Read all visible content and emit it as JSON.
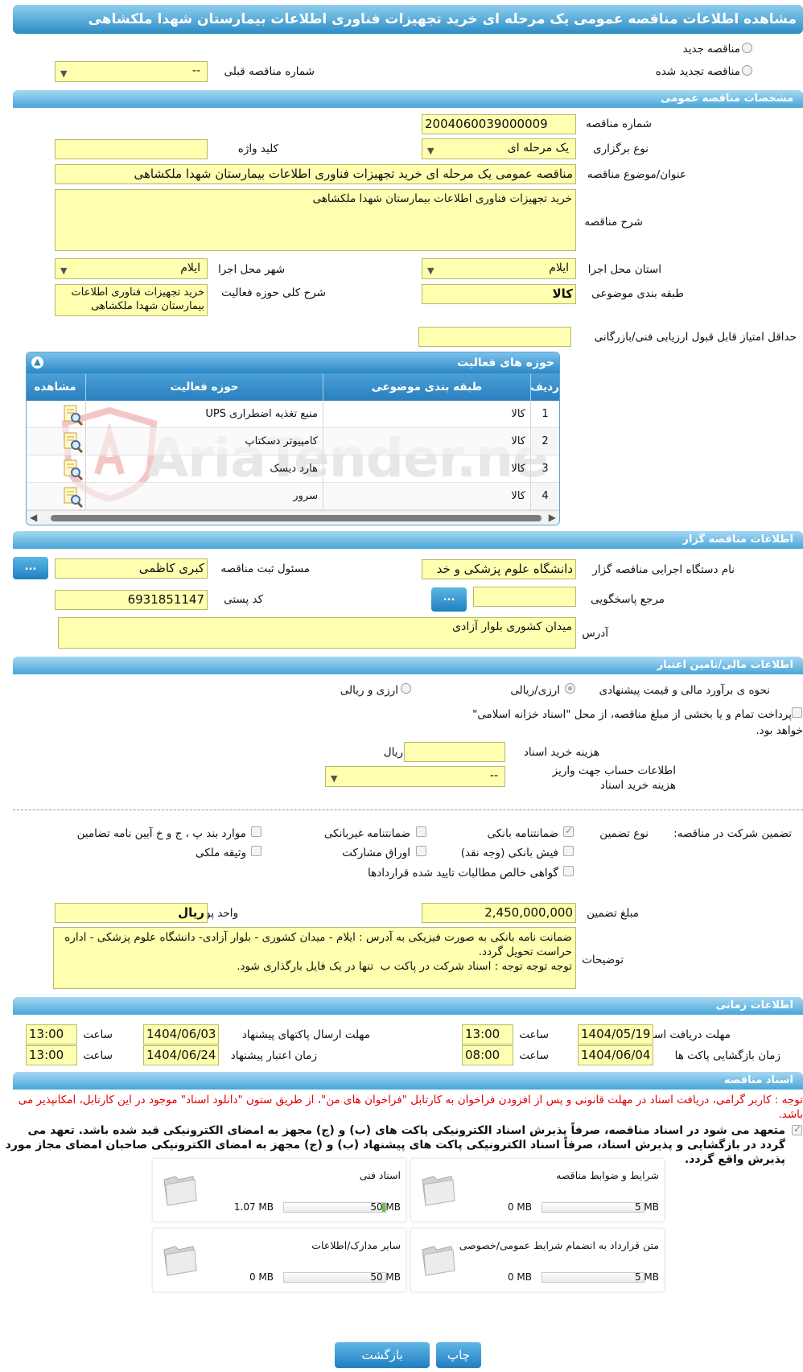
{
  "title": "مشاهده اطلاعات مناقصه عمومی یک مرحله ای خرید تجهیزات فناوری اطلاعات بیمارستان شهدا ملکشاهی",
  "top": {
    "new_tender": "مناقصه جدید",
    "renewed_tender": "مناقصه تجدید شده",
    "prev_number_label": "شماره مناقصه قبلی",
    "prev_number_value": "--"
  },
  "general": {
    "header": "مشخصات مناقصه عمومی",
    "number_label": "شماره مناقصه",
    "number_value": "2004060039000009",
    "type_label": "نوع برگزاری",
    "type_value": "یک مرحله ای",
    "keyword_label": "کلید واژه",
    "keyword_value": "",
    "subject_label": "عنوان/موضوع مناقصه",
    "subject_value": "مناقصه عمومی یک مرحله ای خرید تجهیزات فناوری اطلاعات بیمارستان شهدا ملکشاهی",
    "desc_label": "شرح مناقصه",
    "desc_value": "خرید تجهیزات فناوری اطلاعات بیمارستان شهدا ملکشاهی",
    "province_label": "استان محل اجرا",
    "province_value": "ایلام",
    "city_label": "شهر محل اجرا",
    "city_value": "ایلام",
    "category_label": "طبقه بندی موضوعی",
    "category_value": "کالا",
    "scope_label": "شرح کلی حوزه فعالیت",
    "scope_value": "خرید تجهیزات فناوری اطلاعات بیمارستان شهدا ملکشاهی",
    "min_score_label": "حداقل امتیاز قابل قبول ارزیابی فنی/بازرگانی",
    "min_score_value": ""
  },
  "activities": {
    "title": "حوزه های فعالیت",
    "columns": [
      "ردیف",
      "طبقه بندی موضوعی",
      "حوزه فعالیت",
      "مشاهده"
    ],
    "rows": [
      {
        "idx": "1",
        "cat": "کالا",
        "field": "منبع تغذیه اضطراری UPS"
      },
      {
        "idx": "2",
        "cat": "کالا",
        "field": "کامپیوتر دسکتاپ"
      },
      {
        "idx": "3",
        "cat": "کالا",
        "field": "هارد دیسک"
      },
      {
        "idx": "4",
        "cat": "کالا",
        "field": "سرور"
      }
    ],
    "watermark": "AriaTender.neT"
  },
  "organizer": {
    "header": "اطلاعات مناقصه گزار",
    "org_label": "نام دستگاه اجرایی مناقصه گزار",
    "org_value": "دانشگاه علوم پزشکی و خد",
    "resp_label": "مسئول ثبت مناقصه",
    "resp_value": "کبری کاظمی",
    "ref_label": "مرجع پاسخگویی",
    "ref_value": "",
    "postal_label": "کد پستی",
    "postal_value": "6931851147",
    "address_label": "آدرس",
    "address_value": "میدان کشوری بلوار آزادی",
    "dots": "..."
  },
  "finance": {
    "header": "اطلاعات مالی/تامین اعتبار",
    "estimate_label": "نحوه ی برآورد مالی و قیمت پیشنهادی",
    "opt_currency": "ارزی/ریالی",
    "opt_currency_rial": "ارزی و ریالی",
    "treasury_text": "پرداخت تمام و یا بخشی از مبلغ مناقصه، از محل \"اسناد خزانه اسلامی\"",
    "treasury_text2": "خواهد بود.",
    "doc_cost_label": "هزینه خرید اسناد",
    "doc_cost_value": "",
    "doc_cost_unit": "ریال",
    "account_label": "اطلاعات حساب جهت واریز هزینه خرید اسناد",
    "account_value": "--"
  },
  "guarantee": {
    "participation_label": "تضمین شرکت در مناقصه:",
    "type_label": "نوع تضمین",
    "bank_guarantee": "ضمانتنامه بانکی",
    "non_bank_guarantee": "ضمانتنامه غیربانکی",
    "clauses": "موارد بند پ ، ج و خ آیین نامه تضامین",
    "bank_receipt": "فیش بانکی (وجه نقد)",
    "participation_papers": "اوراق مشارکت",
    "property_bond": "وثیقه ملکی",
    "net_claims": "گواهی خالص مطالبات تایید شده قراردادها",
    "amount_label": "مبلغ تضمین",
    "amount_value": "2,450,000,000",
    "currency_label": "واحد پول",
    "currency_value": "ریال",
    "notes_label": "توضیحات",
    "notes_value": "ضمانت نامه بانکی به صورت فیزیکی به آدرس : ایلام - میدان کشوری - بلوار آزادی- دانشگاه علوم پزشکی - اداره حراست تحویل گردد.\nتوجه توجه توجه : اسناد شرکت در پاکت ب  تنها در یک فایل بارگذاری شود."
  },
  "timing": {
    "header": "اطلاعات زمانی",
    "receive_label": "مهلت دریافت اسناد",
    "receive_date": "1404/05/19",
    "receive_time": "13:00",
    "send_label": "مهلت ارسال پاکتهای پیشنهاد",
    "send_date": "1404/06/03",
    "send_time": "13:00",
    "open_label": "زمان بازگشایی پاکت ها",
    "open_date": "1404/06/04",
    "open_time": "08:00",
    "valid_label": "زمان اعتبار پیشنهاد",
    "valid_date": "1404/06/24",
    "valid_time": "13:00",
    "time_word": "ساعت"
  },
  "documents": {
    "header": "اسناد مناقصه",
    "red_note": "توجه : کاربر گرامی، دریافت اسناد در مهلت قانونی و پس از افزودن فراخوان به کارتابل \"فراخوان های من\"، از طریق ستون \"دانلود اسناد\" موجود در این کارتابل، امکانپذیر می باشد.",
    "bold_note": "متعهد می شود در اسناد مناقصه، صرفاً پذیرش اسناد الکترونیکی پاکت های (ب) و (ج) مجهز به امضای الکترونیکی قید شده باشد. تعهد می گردد در بازگشایی و پذیرش اسناد، صرفاً اسناد الکترونیکی پاکت های پیشنهاد (ب) و (ج) مجهز به امضای الکترونیکی صاحبان امضای مجاز مورد پذیرش واقع گردد.",
    "files": [
      {
        "name": "شرایط و ضوابط مناقصه",
        "used": "0 MB",
        "max": "5 MB",
        "fill": 0
      },
      {
        "name": "اسناد فنی",
        "used": "1.07 MB",
        "max": "50 MB",
        "fill": 0.0214
      },
      {
        "name": "متن قرارداد به انضمام شرایط عمومی/خصوصی",
        "used": "0 MB",
        "max": "5 MB",
        "fill": 0
      },
      {
        "name": "سایر مدارک/اطلاعات",
        "used": "0 MB",
        "max": "50 MB",
        "fill": 0
      }
    ]
  },
  "buttons": {
    "print": "چاپ",
    "back": "بازگشت"
  }
}
